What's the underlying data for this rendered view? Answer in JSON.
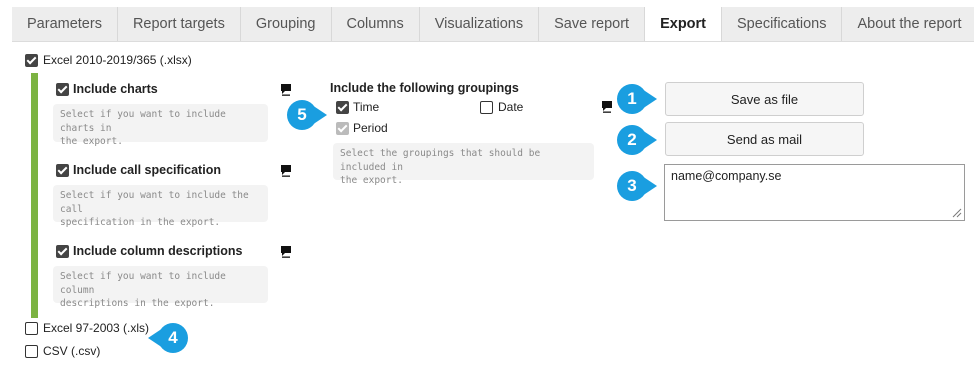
{
  "tabs": [
    {
      "label": "Parameters"
    },
    {
      "label": "Report targets"
    },
    {
      "label": "Grouping"
    },
    {
      "label": "Columns"
    },
    {
      "label": "Visualizations"
    },
    {
      "label": "Save report"
    },
    {
      "label": "Export"
    },
    {
      "label": "Specifications"
    },
    {
      "label": "About the report"
    }
  ],
  "active_tab": "Export",
  "formats": {
    "xlsx": {
      "label": "Excel 2010-2019/365 (.xlsx)",
      "checked": true
    },
    "xls": {
      "label": "Excel 97-2003 (.xls)",
      "checked": false
    },
    "csv": {
      "label": "CSV (.csv)",
      "checked": false
    }
  },
  "options": {
    "include_charts": {
      "label": "Include charts",
      "help": [
        "Select if you want to include charts in",
        "the export."
      ],
      "checked": true
    },
    "include_call_spec": {
      "label": "Include call specification",
      "help": [
        "Select if you want to include the call",
        "specification in the export."
      ],
      "checked": true
    },
    "include_column_desc": {
      "label": "Include column descriptions",
      "help": [
        "Select if you want to include column",
        "descriptions in the export."
      ],
      "checked": true
    }
  },
  "groupings": {
    "heading": "Include the following groupings",
    "time": {
      "label": "Time",
      "checked": true
    },
    "date": {
      "label": "Date",
      "checked": false
    },
    "period": {
      "label": "Period",
      "checked": true,
      "disabled": true
    },
    "help": [
      "Select the groupings that should be included in",
      "the export."
    ]
  },
  "actions": {
    "save_file": "Save as file",
    "send_mail": "Send as mail",
    "email_value": "name@company.se"
  },
  "badges": [
    "1",
    "2",
    "3",
    "4",
    "5"
  ],
  "colors": {
    "accent_green": "#7cb342",
    "badge_blue": "#1a9ee0",
    "checkbox_dark": "#444444"
  }
}
